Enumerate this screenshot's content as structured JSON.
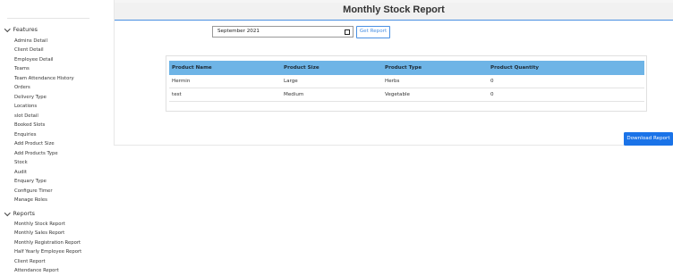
{
  "sidebar": {
    "features_label": "Features",
    "features_items": [
      "Admins Detail",
      "Client Detail",
      "Employee Detail",
      "Teams",
      "Team Attendance History",
      "Orders",
      "Delivery Type",
      "Locations",
      "slot Detail",
      "Booked Slots",
      "Enquiries",
      "Add Product Size",
      "Add Products Type",
      "Stock",
      "Audit",
      "Enquary Type",
      "Configure Timer",
      "Manage Roles"
    ],
    "reports_label": "Reports",
    "reports_items": [
      "Monthly Stock Report",
      "Monthly Sales Report",
      "Monthly Registration Report",
      "Half Yearly Employee Report",
      "Client Report",
      "Attendance Report"
    ]
  },
  "header": {
    "title": "Monthly Stock Report"
  },
  "filter": {
    "month_value": "September 2021",
    "get_report_label": "Get Report"
  },
  "table": {
    "columns": [
      "Product Name",
      "Product Size",
      "Product Type",
      "Product Quantity"
    ],
    "rows": [
      [
        "Hermin",
        "Large",
        "Herbs",
        "0"
      ],
      [
        "test",
        "Medium",
        "Vegetable",
        "0"
      ]
    ]
  },
  "download_label": "Download Report",
  "colors": {
    "accent": "#4a90e2",
    "table_header": "#6eb4e6",
    "download_button": "#1a73e8"
  }
}
